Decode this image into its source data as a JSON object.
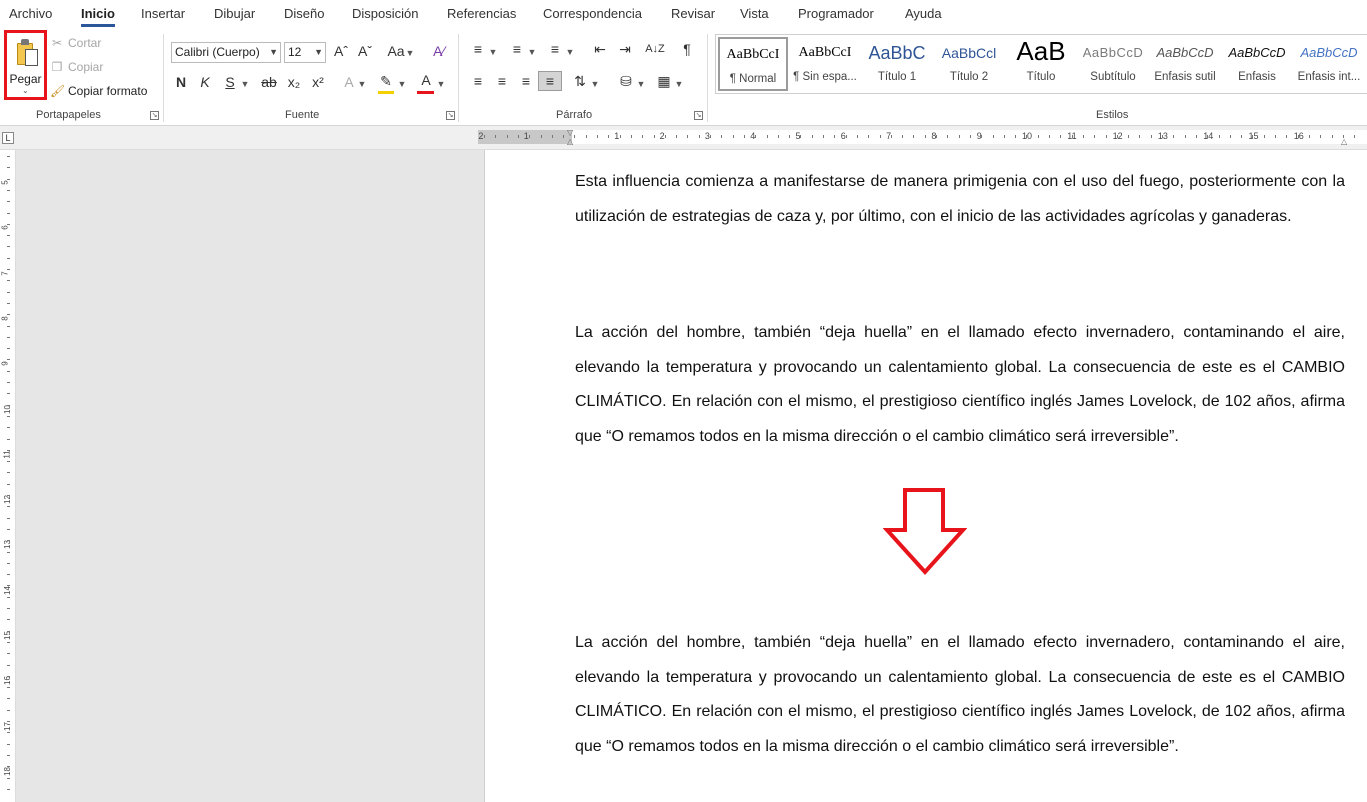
{
  "menu": {
    "tabs": [
      "Archivo",
      "Inicio",
      "Insertar",
      "Dibujar",
      "Diseño",
      "Disposición",
      "Referencias",
      "Correspondencia",
      "Revisar",
      "Vista",
      "Programador",
      "Ayuda"
    ],
    "active": "Inicio"
  },
  "clipboard": {
    "paste_label": "Pegar",
    "cut_label": "Cortar",
    "copy_label": "Copiar",
    "format_painter_label": "Copiar formato",
    "group_label": "Portapapeles"
  },
  "font": {
    "family": "Calibri (Cuerpo)",
    "size": "12",
    "grow": "Aˆ",
    "shrink": "Aˇ",
    "case": "Aa",
    "bold": "N",
    "italic": "K",
    "underline": "S",
    "strike": "ab",
    "subscript": "x₂",
    "superscript": "x²",
    "effects": "A",
    "color_letter": "A",
    "group_label": "Fuente",
    "font_color": "#e8141b",
    "highlight_color": "#f5d000"
  },
  "paragraph": {
    "group_label": "Párrafo",
    "pilcrow": "¶",
    "sort": "A↓Z"
  },
  "styles": {
    "group_label": "Estilos",
    "items": [
      {
        "preview": "AaBbCcI",
        "name": "¶ Normal"
      },
      {
        "preview": "AaBbCcI",
        "name": "¶ Sin espa..."
      },
      {
        "preview": "AaBbC",
        "name": "Título 1"
      },
      {
        "preview": "AaBbCcl",
        "name": "Título 2"
      },
      {
        "preview": "AaB",
        "name": "Título"
      },
      {
        "preview": "AaBbCcD",
        "name": "Subtítulo"
      },
      {
        "preview": "AaBbCcD",
        "name": "Énfasis sutil"
      },
      {
        "preview": "AaBbCcD",
        "name": "Énfasis"
      },
      {
        "preview": "AaBbCcD",
        "name": "Énfasis int..."
      }
    ]
  },
  "ruler": {
    "corner": "L",
    "h_numbers": [
      "2",
      "1",
      "1",
      "2",
      "3",
      "4",
      "5",
      "6",
      "7",
      "8",
      "9",
      "10",
      "11",
      "12",
      "13",
      "14",
      "15",
      "16"
    ],
    "v_numbers": [
      "5",
      "6",
      "7",
      "8",
      "9",
      "10",
      "11",
      "12",
      "13",
      "14",
      "15",
      "16",
      "17",
      "18"
    ]
  },
  "document": {
    "paragraphs": [
      "Esta influencia comienza a manifestarse de manera primigenia con el uso del fuego, posteriormente con la utilización de estrategias de caza y, por último, con el inicio de las actividades agrícolas y ganaderas.",
      "La acción del hombre, también “deja huella” en el llamado efecto invernadero, contaminando el aire, elevando la temperatura y provocando un calentamiento global. La consecuencia de este es el CAMBIO CLIMÁTICO. En relación con el mismo, el prestigioso científico inglés James Lovelock, de 102 años, afirma que “O remamos todos en la misma dirección o el cambio climático será irreversible”.",
      "La acción del hombre, también “deja huella” en el llamado efecto invernadero, contaminando el aire, elevando la temperatura y provocando un calentamiento global. La consecuencia de este es el CAMBIO CLIMÁTICO. En relación con el mismo, el prestigioso científico inglés James Lovelock, de 102 años, afirma que “O remamos todos en la misma dirección o el cambio climático será irreversible”."
    ],
    "arrow_color": "#e8141b"
  },
  "colors": {
    "accent": "#2b579a",
    "highlight_box": "#e8141b"
  }
}
